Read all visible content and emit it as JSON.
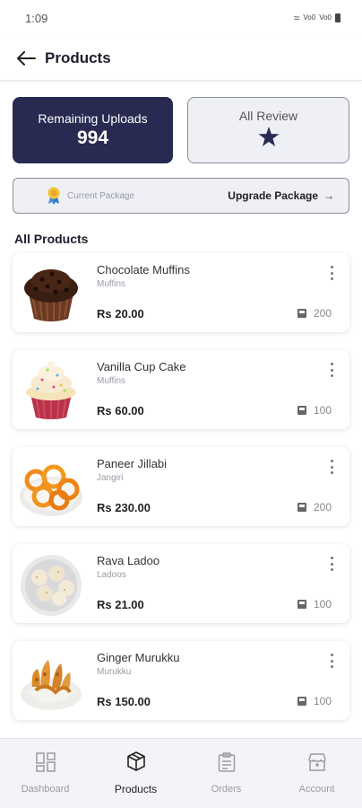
{
  "status_bar": {
    "time": "1:09",
    "net1": "Vo0",
    "net2": "Vo0"
  },
  "header": {
    "title": "Products"
  },
  "stats": {
    "remaining_label": "Remaining Uploads",
    "remaining_value": "994",
    "review_label": "All Review"
  },
  "package": {
    "current_label": "Current Package",
    "upgrade_label": "Upgrade Package",
    "upgrade_arrow": "→"
  },
  "section_title": "All Products",
  "products": [
    {
      "name": "Chocolate Muffins",
      "category": "Muffins",
      "price": "Rs 20.00",
      "stock": "200"
    },
    {
      "name": "Vanilla Cup Cake",
      "category": "Muffins",
      "price": "Rs 60.00",
      "stock": "100"
    },
    {
      "name": "Paneer Jillabi",
      "category": "Jangiri",
      "price": "Rs 230.00",
      "stock": "200"
    },
    {
      "name": "Rava Ladoo",
      "category": "Ladoos",
      "price": "Rs 21.00",
      "stock": "100"
    },
    {
      "name": "Ginger Murukku",
      "category": "Murukku",
      "price": "Rs 150.00",
      "stock": "100"
    }
  ],
  "nav": [
    {
      "label": "Dashboard",
      "icon": "dashboard-icon"
    },
    {
      "label": "Products",
      "icon": "box-icon"
    },
    {
      "label": "Orders",
      "icon": "clipboard-icon"
    },
    {
      "label": "Account",
      "icon": "store-icon"
    }
  ],
  "colors": {
    "primary": "#282a52",
    "card_light": "#eef0f5",
    "muted": "#9a9aa5"
  }
}
